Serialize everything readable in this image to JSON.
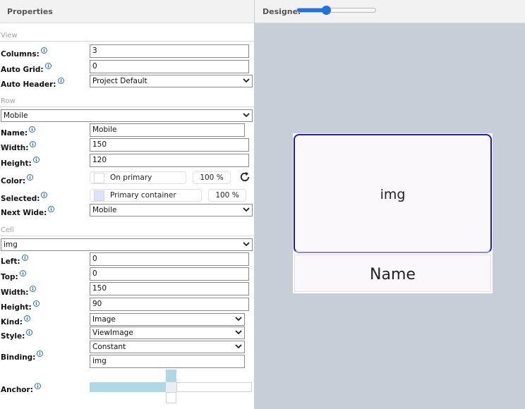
{
  "properties": {
    "title": "Properties",
    "sections": {
      "view": "View",
      "row": "Row",
      "cell": "Cell"
    },
    "view": {
      "columns": {
        "label": "Columns:",
        "value": "3"
      },
      "auto_grid": {
        "label": "Auto Grid:",
        "value": "0"
      },
      "auto_header": {
        "label": "Auto Header:",
        "value": "Project Default"
      }
    },
    "row": {
      "selector": "Mobile",
      "name": {
        "label": "Name:",
        "value": "Mobile"
      },
      "width": {
        "label": "Width:",
        "value": "150"
      },
      "height": {
        "label": "Height:",
        "value": "120"
      },
      "color": {
        "label": "Color:",
        "swatch_text": "On primary",
        "swatch_color": "#ffffff",
        "opacity": "100 %"
      },
      "selected": {
        "label": "Selected:",
        "swatch_text": "Primary container",
        "swatch_color": "#dde3fb",
        "opacity": "100 %"
      },
      "next_wide": {
        "label": "Next Wide:",
        "value": "Mobile"
      }
    },
    "cell": {
      "selector": "img",
      "left": {
        "label": "Left:",
        "value": "0"
      },
      "top": {
        "label": "Top:",
        "value": "0"
      },
      "width": {
        "label": "Width:",
        "value": "150"
      },
      "height": {
        "label": "Height:",
        "value": "90"
      },
      "kind": {
        "label": "Kind:",
        "value": "Image"
      },
      "style": {
        "label": "Style:",
        "value": "ViewImage"
      },
      "binding": {
        "label": "Binding:",
        "type": "Constant",
        "value": "img"
      },
      "anchor": {
        "label": "Anchor:",
        "left": true,
        "top": true,
        "right": false,
        "bottom": false
      }
    }
  },
  "designer": {
    "title": "Designer",
    "zoom_fraction": 0.38,
    "cells": {
      "img": "img",
      "name": "Name"
    }
  },
  "colors": {
    "accent": "#1a73e8",
    "info_icon": "#1565c0",
    "anchor_active": "#aed8e3",
    "canvas": "#c8ced8"
  }
}
